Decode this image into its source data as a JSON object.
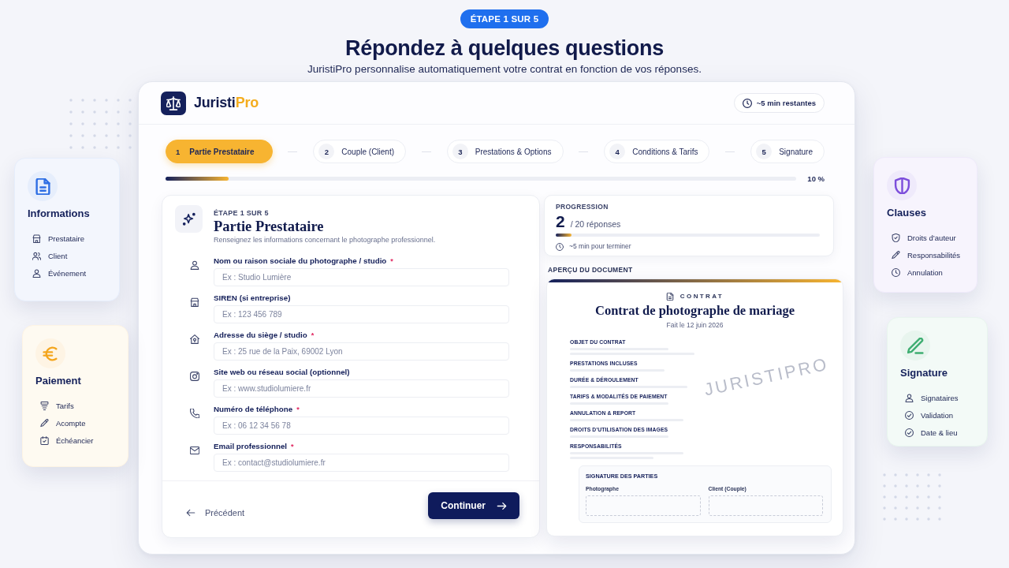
{
  "hero": {
    "badge": "ÉTAPE 1 SUR 5",
    "title": "Répondez à quelques questions",
    "subtitle": "JuristiPro personnalise automatiquement votre contrat en fonction de vos réponses."
  },
  "app": {
    "brand": {
      "name": "Juristi",
      "accent": "Pro"
    },
    "time_remaining": "~5 min restantes"
  },
  "stepper": {
    "steps": [
      {
        "number": "1",
        "label": "Partie Prestataire",
        "selected": true
      },
      {
        "number": "2",
        "label": "Couple (Client)",
        "selected": false
      },
      {
        "number": "3",
        "label": "Prestations & Options",
        "selected": false
      },
      {
        "number": "4",
        "label": "Conditions & Tarifs",
        "selected": false
      },
      {
        "number": "5",
        "label": "Signature",
        "selected": false
      }
    ],
    "progress": {
      "level": 0.1,
      "reading": "10 %"
    }
  },
  "form": {
    "step_label": "ÉTAPE 1 SUR 5",
    "title": "Partie Prestataire",
    "description": "Renseignez les informations concernant le photographe professionnel.",
    "fields": [
      {
        "label": "Nom ou raison sociale du photographe / studio",
        "required_mark": "*",
        "placeholder": "Ex : Studio Lumière"
      },
      {
        "label": "SIREN (si entreprise)",
        "placeholder": "Ex : 123 456 789"
      },
      {
        "label": "Adresse du siège / studio",
        "required_mark": "*",
        "placeholder": "Ex : 25 rue de la Paix, 69002 Lyon"
      },
      {
        "label": "Site web ou réseau social (optionnel)",
        "placeholder": "Ex : www.studiolumiere.fr"
      },
      {
        "label": "Numéro de téléphone",
        "required_mark": "*",
        "placeholder": "Ex : 06 12 34 56 78"
      },
      {
        "label": "Email professionnel",
        "required_mark": "*",
        "placeholder": "Ex : contact@studiolumiere.fr"
      }
    ],
    "back_button": "Précédent",
    "next_button": "Continuer"
  },
  "progress_panel": {
    "title": "PROGRESSION",
    "count": "2",
    "total": "/ 20 réponses",
    "level": 0.06,
    "estimate": "~5 min pour terminer"
  },
  "document_preview": {
    "label": "APERÇU DU DOCUMENT",
    "kicker": "CONTRAT",
    "title": "Contrat de photographe de mariage",
    "date": "Fait le 12 juin 2026",
    "watermark": "JURISTIPRO",
    "sections": [
      "OBJET DU CONTRAT",
      "PRESTATIONS INCLUSES",
      "DURÉE & DÉROULEMENT",
      "TARIFS & MODALITÉS DE PAIEMENT",
      "ANNULATION & REPORT",
      "DROITS D’UTILISATION DES IMAGES",
      "RESPONSABILITÉS"
    ],
    "signature": {
      "title": "SIGNATURE DES PARTIES",
      "parties": [
        "Photographe",
        "Client (Couple)"
      ]
    }
  },
  "feature_cards": [
    {
      "title": "Informations",
      "color": "#2f6fe4",
      "items": [
        "Prestataire",
        "Client",
        "Événement"
      ]
    },
    {
      "title": "Paiement",
      "color": "#f4a51c",
      "items": [
        "Tarifs",
        "Acompte",
        "Échéancier"
      ]
    },
    {
      "title": "Clauses",
      "color": "#7c4ddb",
      "items": [
        "Droits d’auteur",
        "Responsabilités",
        "Annulation"
      ]
    },
    {
      "title": "Signature",
      "color": "#3fae72",
      "items": [
        "Signataires",
        "Validation",
        "Date & lieu"
      ]
    }
  ]
}
